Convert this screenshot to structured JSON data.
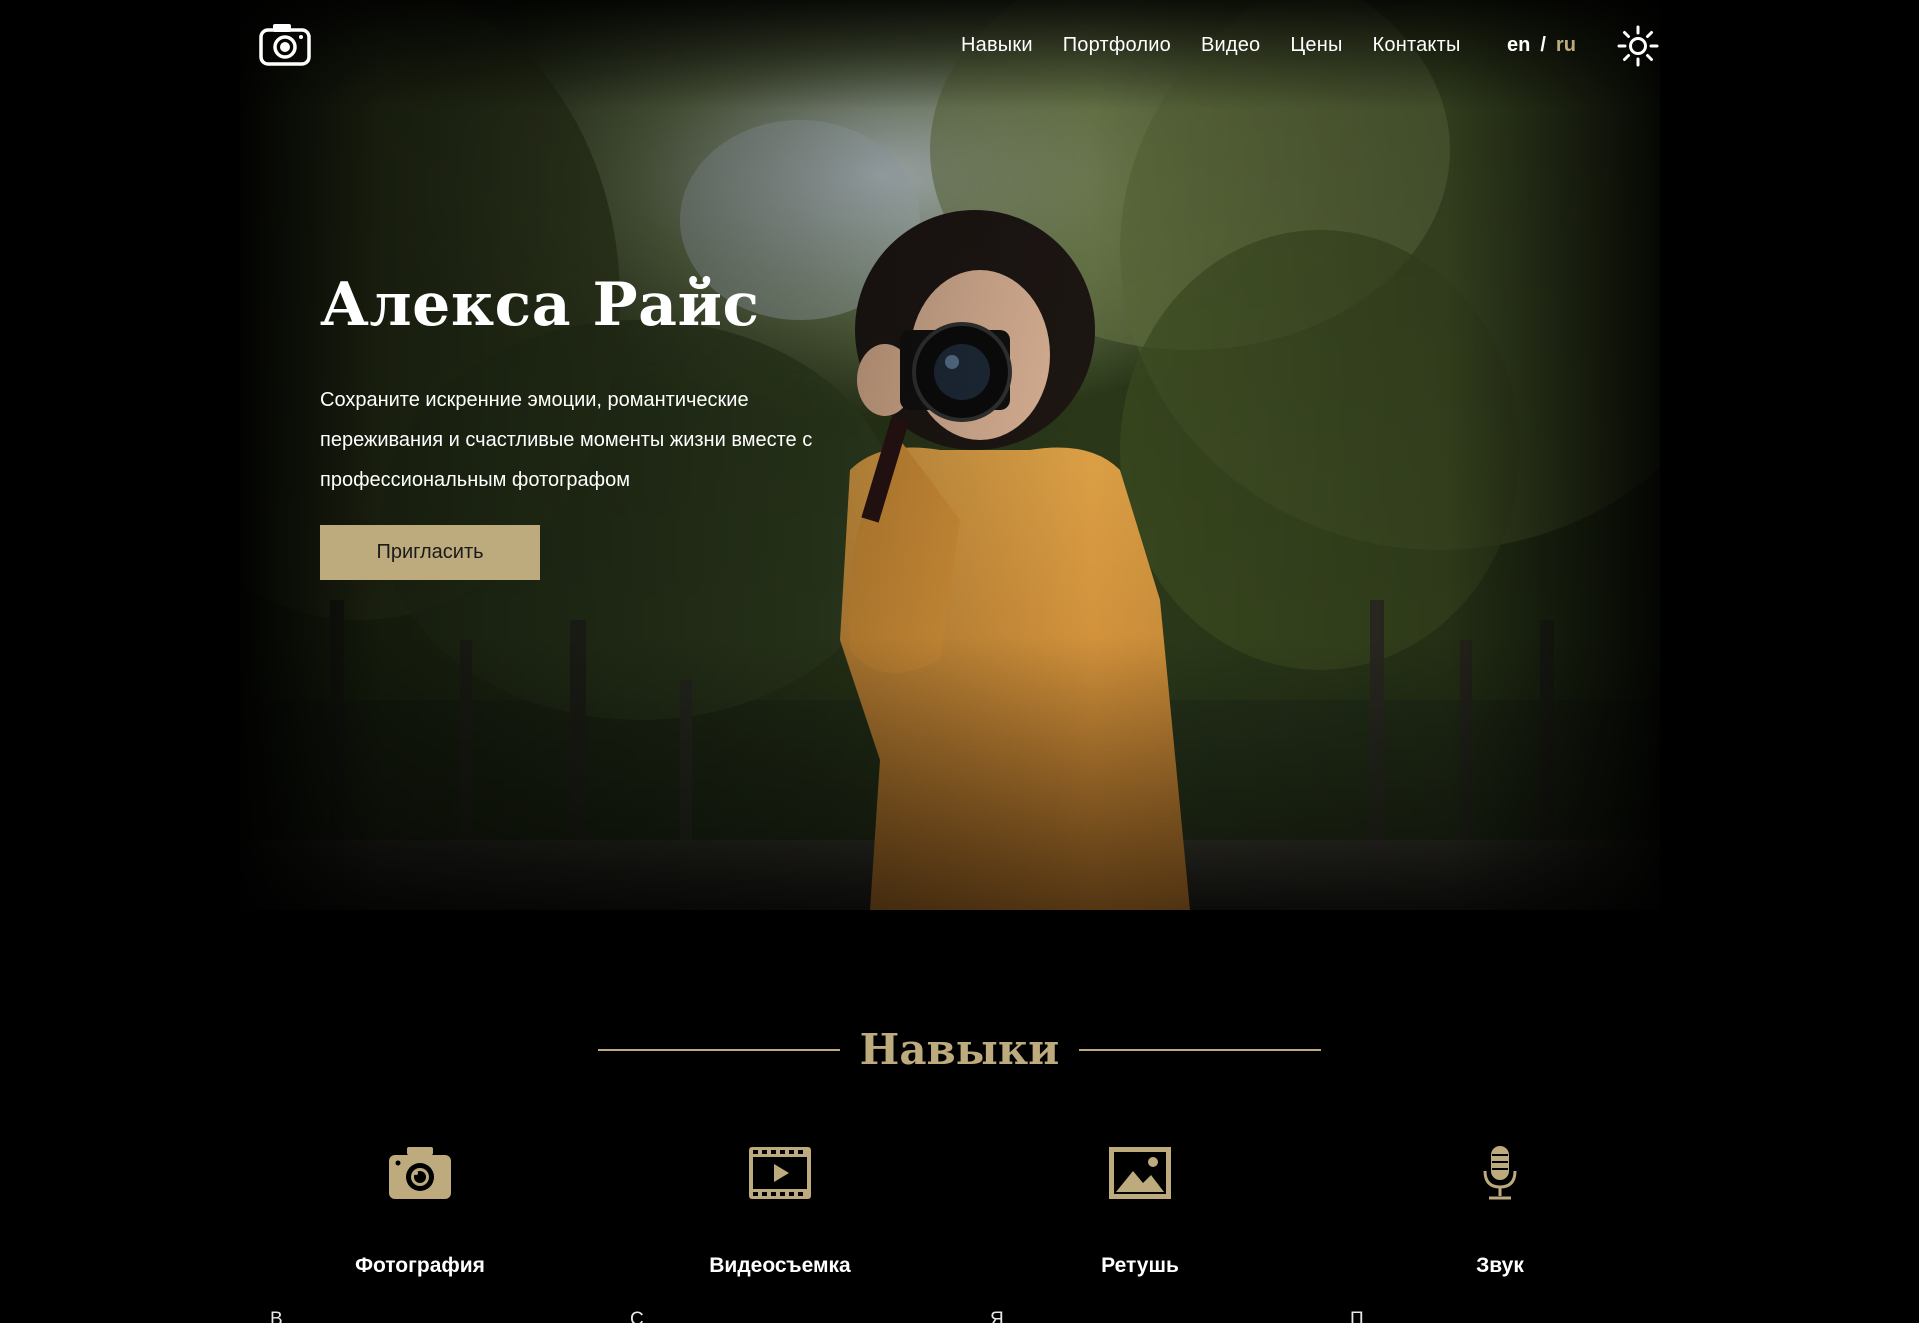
{
  "header": {
    "logo_icon": "camera-icon",
    "nav": [
      {
        "label": "Навыки"
      },
      {
        "label": "Портфолио"
      },
      {
        "label": "Видео"
      },
      {
        "label": "Цены"
      },
      {
        "label": "Контакты"
      }
    ],
    "lang": {
      "en": "en",
      "separator": "/",
      "ru": "ru",
      "active": "ru"
    },
    "theme_icon": "sun-icon"
  },
  "hero": {
    "title": "Алекса Райс",
    "description": "Сохраните искренние эмоции, романтические переживания и счастливые моменты жизни вместе с профессиональным фотографом",
    "button_label": "Пригласить"
  },
  "skills": {
    "title": "Навыки",
    "items": [
      {
        "icon": "camera-icon",
        "title": "Фотография",
        "text": "В"
      },
      {
        "icon": "video-icon",
        "title": "Видеосъемка",
        "text": "С"
      },
      {
        "icon": "image-icon",
        "title": "Ретушь",
        "text": "Я"
      },
      {
        "icon": "microphone-icon",
        "title": "Звук",
        "text": "П"
      }
    ]
  },
  "colors": {
    "accent": "#bdab7e",
    "background": "#000000",
    "text": "#ffffff"
  }
}
